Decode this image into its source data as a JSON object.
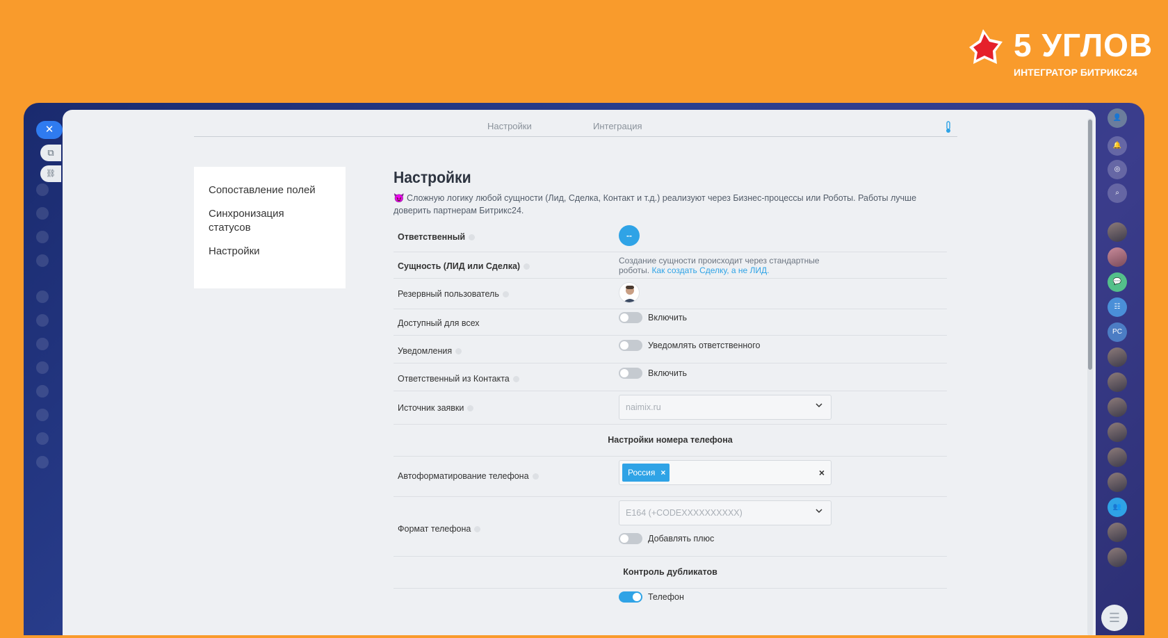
{
  "brand": {
    "name": "5 УГЛОВ",
    "subtitle": "ИНТЕГРАТОР БИТРИКС24"
  },
  "tabs": {
    "settings": "Настройки",
    "integration": "Интеграция"
  },
  "menu": {
    "items": [
      "Сопоставление полей",
      "Синхронизация статусов",
      "Настройки"
    ]
  },
  "page": {
    "title": "Настройки",
    "intro": "Сложную логику любой сущности (Лид, Сделка, Контакт и т.д.) реализуют через Бизнес-процессы или Роботы. Работы лучше доверить партнерам Битрикс24."
  },
  "fields": {
    "responsible": {
      "label": "Ответственный",
      "value": "--"
    },
    "entity": {
      "label": "Сущность (ЛИД или Сделка)",
      "note": "Создание сущности происходит через стандартные роботы.",
      "link": "Как создать Сделку, а не ЛИД."
    },
    "reserve_user": {
      "label": "Резервный пользователь"
    },
    "available_all": {
      "label": "Доступный для всех",
      "toggle_label": "Включить",
      "on": false
    },
    "notifications": {
      "label": "Уведомления",
      "toggle_label": "Уведомлять ответственного",
      "on": false
    },
    "resp_contact": {
      "label": "Ответственный из Контакта",
      "toggle_label": "Включить",
      "on": false
    },
    "source": {
      "label": "Источник заявки",
      "value": "naimix.ru"
    }
  },
  "phone_section": {
    "title": "Настройки номера телефона",
    "autoformat": {
      "label": "Автоформатирование телефона",
      "tag": "Россия",
      "tag_remove": "×",
      "clear": "×"
    },
    "format": {
      "label": "Формат телефона",
      "value": "E164 (+CODEXXXXXXXXXX)",
      "plus_label": "Добавлять плюс",
      "plus_on": false
    }
  },
  "dup_section": {
    "title": "Контроль дубликатов",
    "phone": {
      "label": "Телефон",
      "on": true
    }
  },
  "icons": {
    "close": "✕",
    "external": "⧉",
    "link": "🔗",
    "chat": "☰"
  },
  "rightbar": {
    "pc_label": "PC"
  },
  "colors": {
    "brand_orange": "#f99b2c",
    "accent_blue": "#2fa3e6",
    "toggle_off": "#c5cad0"
  }
}
